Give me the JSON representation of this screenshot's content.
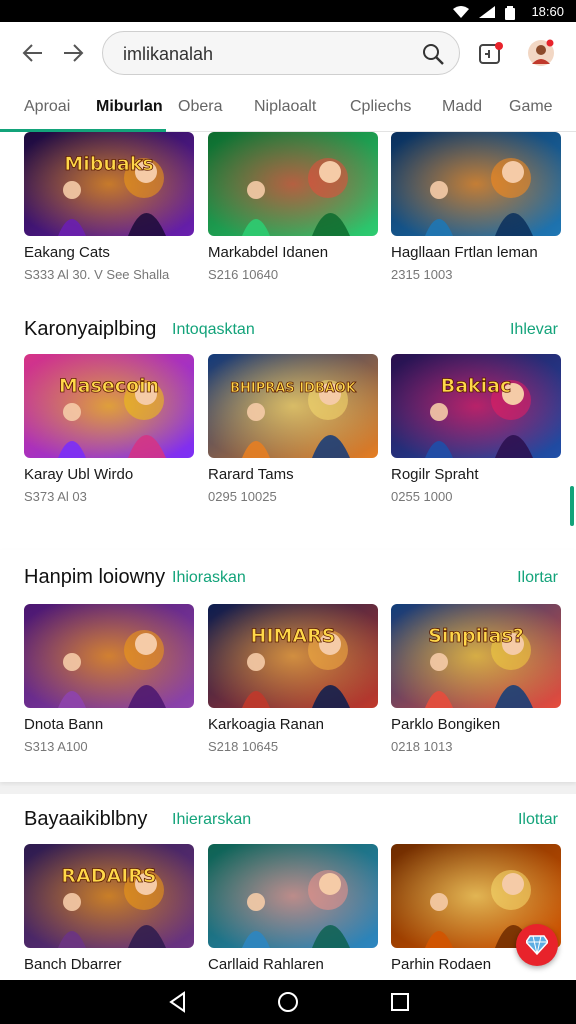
{
  "status_bar": {
    "time": "18:60"
  },
  "search": {
    "query": "imlikanalah"
  },
  "tabs": [
    {
      "label": "Aproai",
      "active": false
    },
    {
      "label": "Miburlan",
      "active": true
    },
    {
      "label": "Obera",
      "active": false
    },
    {
      "label": "Niplaoalt",
      "active": false
    },
    {
      "label": "Cpliechs",
      "active": false
    },
    {
      "label": "Madd",
      "active": false
    },
    {
      "label": "Game",
      "active": false
    }
  ],
  "sections": [
    {
      "title": "",
      "subtitle": "",
      "more": "",
      "games": [
        {
          "name": "Eakang Cats",
          "meta": "S333 Al 30. V See Shalla",
          "art_text": "Mibuaks",
          "colors": [
            "#1b0b3a",
            "#6a1fb0",
            "#f39c12"
          ]
        },
        {
          "name": "Markabdel Idanen",
          "meta": "S216 10640",
          "art_text": "",
          "colors": [
            "#0d6b2e",
            "#2ecc71",
            "#e74c3c"
          ]
        },
        {
          "name": "Hagllaan Frtlan leman",
          "meta": "2315 1003",
          "art_text": "",
          "colors": [
            "#0a2f5c",
            "#1f77b4",
            "#ff8c1a"
          ]
        }
      ]
    },
    {
      "title": "Karonyaiplbing",
      "subtitle": "Intoqasktan",
      "more": "Ihlevar",
      "games": [
        {
          "name": "Karay Ubl Wirdo",
          "meta": "S373 Al 03",
          "art_text": "Masecoin",
          "colors": [
            "#d63384",
            "#7b2ff7",
            "#f1c40f"
          ]
        },
        {
          "name": "Rarard Tams",
          "meta": "0295 10025",
          "art_text": "BHIPRAS IDBAOK",
          "colors": [
            "#123a7a",
            "#e67e22",
            "#f7dc6f"
          ]
        },
        {
          "name": "Rogilr Spraht",
          "meta": "0255 1000",
          "art_text": "Bakiac",
          "colors": [
            "#2a0f4d",
            "#1f4fa8",
            "#e91e63"
          ]
        }
      ]
    },
    {
      "title": "Hanpim loiowny",
      "subtitle": "Ihioraskan",
      "more": "Ilortar",
      "games": [
        {
          "name": "Dnota Bann",
          "meta": "S313 A100",
          "art_text": "",
          "colors": [
            "#4a1670",
            "#8e44ad",
            "#f39c12"
          ]
        },
        {
          "name": "Karkoagia Ranan",
          "meta": "S218 10645",
          "art_text": "HIMARS",
          "colors": [
            "#0b1d4f",
            "#c0392b",
            "#f5b041"
          ]
        },
        {
          "name": "Parklo Bongiken",
          "meta": "0218 1013",
          "art_text": "Sinpiias?",
          "colors": [
            "#0f3d7a",
            "#e74c3c",
            "#f4d03f"
          ]
        }
      ]
    },
    {
      "title": "Bayaaikiblbny",
      "subtitle": "Ihierarskan",
      "more": "Ilottar",
      "games": [
        {
          "name": "Banch Dbarrer",
          "meta": "",
          "art_text": "RADAIRS",
          "colors": [
            "#2d1b4e",
            "#6c3483",
            "#f39c12"
          ]
        },
        {
          "name": "Carllaid Rahlaren",
          "meta": "",
          "art_text": "",
          "colors": [
            "#0e6251",
            "#2e86c1",
            "#f1948a"
          ]
        },
        {
          "name": "Parhin Rodaen",
          "meta": "",
          "art_text": "",
          "colors": [
            "#6e2c00",
            "#d35400",
            "#f7dc6f"
          ]
        }
      ]
    }
  ]
}
